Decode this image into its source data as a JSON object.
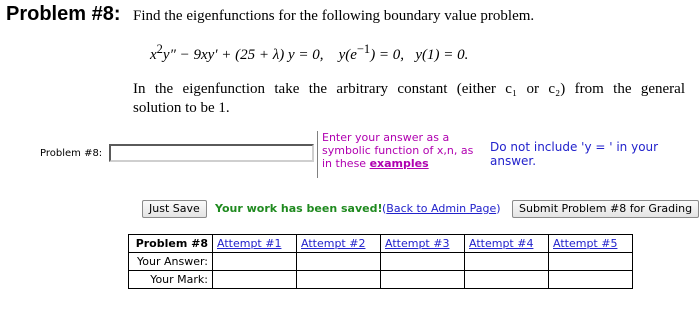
{
  "problem": {
    "title": "Problem #8:",
    "description": "Find the eigenfunctions for the following boundary value problem.",
    "equation": {
      "ode_a": "x",
      "ode_a_sup": "2",
      "ode_b": "y″ − 9xy′ + (25 + λ) y = 0,",
      "bc1_pre": "y(e",
      "bc1_sup": "−1",
      "bc1_post": ") = 0,",
      "bc2": "y(1) = 0."
    },
    "instruction_line1": "In the eigenfunction take the arbitrary constant (either c₁ or c₂) from the general",
    "instruction_line2": "solution to be 1."
  },
  "answer": {
    "label": "Problem #8:",
    "value": "",
    "hint_line1": "Enter your answer as a",
    "hint_line2": "symbolic function of x,n, as",
    "hint_line3_pre": "in these ",
    "hint_link": "examples",
    "y_note": "Do not include 'y = ' in your answer."
  },
  "actions": {
    "save_label": "Just Save",
    "saved_message": "Your work has been saved!",
    "admin_link_open": "(",
    "admin_link_text": "Back to Admin Page",
    "admin_link_close": ")",
    "submit_label": "Submit Problem #8 for Grading"
  },
  "attempts": {
    "header": "Problem #8",
    "columns": [
      "Attempt #1",
      "Attempt #2",
      "Attempt #3",
      "Attempt #4",
      "Attempt #5"
    ],
    "row_answer": "Your Answer:",
    "row_mark": "Your Mark:"
  },
  "colors": {
    "hint": "#b000b0",
    "link": "#2222cc",
    "saved": "#1f8a1f"
  }
}
